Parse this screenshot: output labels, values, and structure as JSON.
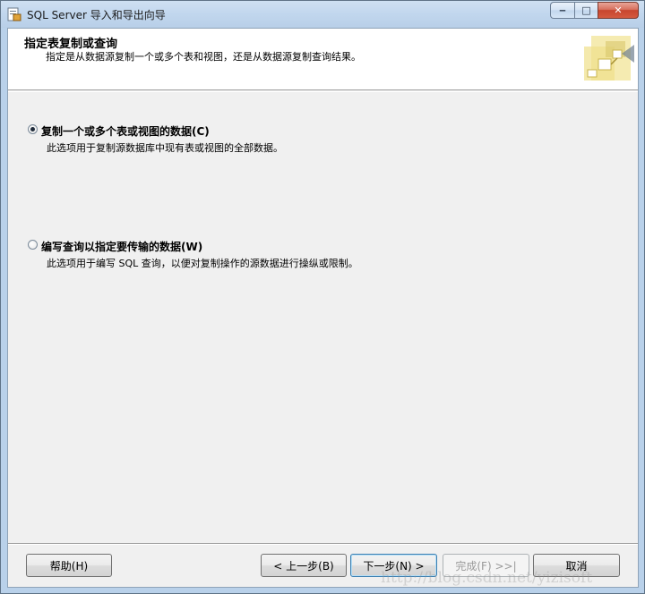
{
  "window": {
    "title": "SQL Server 导入和导出向导",
    "minimize": "‒",
    "maximize": "□",
    "close": "✕"
  },
  "header": {
    "title": "指定表复制或查询",
    "subtitle": "指定是从数据源复制一个或多个表和视图，还是从数据源复制查询结果。"
  },
  "options": [
    {
      "label": "复制一个或多个表或视图的数据(C)",
      "description": "此选项用于复制源数据库中现有表或视图的全部数据。",
      "selected": true
    },
    {
      "label": "编写查询以指定要传输的数据(W)",
      "description": "此选项用于编写 SQL 查询，以便对复制操作的源数据进行操纵或限制。",
      "selected": false
    }
  ],
  "buttons": {
    "help": "帮助(H)",
    "back": "< 上一步(B)",
    "next": "下一步(N) >",
    "finish": "完成(F) >>|",
    "cancel": "取消"
  },
  "watermark": "http://blog.csdn.net/yizisoft",
  "colors": {
    "window_frame": "#b9d1ea",
    "client": "#f0f0f0",
    "header": "#ffffff",
    "close_button": "#c7452e"
  }
}
